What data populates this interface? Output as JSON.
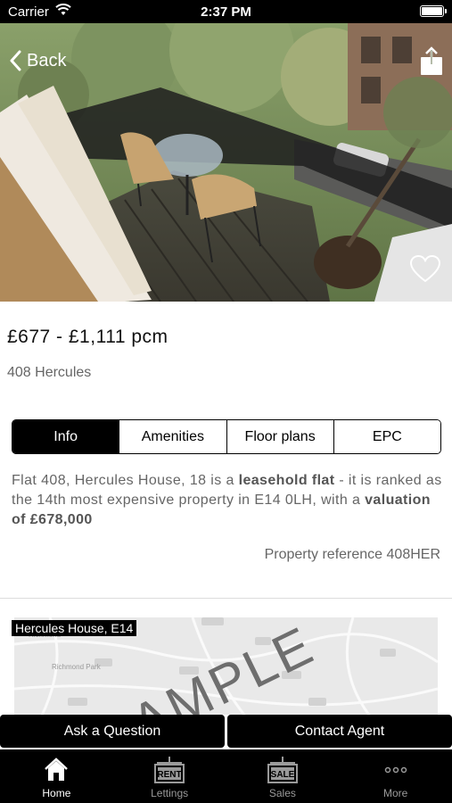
{
  "status_bar": {
    "carrier": "Carrier",
    "time": "2:37 PM",
    "battery_level": 1.0
  },
  "header": {
    "back_label": "Back",
    "share_icon": "share-icon",
    "favorite_icon": "heart-icon"
  },
  "listing": {
    "price": "£677 - £1,111 pcm",
    "address": "408 Hercules"
  },
  "tabs": [
    {
      "label": "Info",
      "active": true
    },
    {
      "label": "Amenities",
      "active": false
    },
    {
      "label": "Floor plans",
      "active": false
    },
    {
      "label": "EPC",
      "active": false
    }
  ],
  "info": {
    "desc_part1": "Flat 408, Hercules House, 18 is a ",
    "desc_bold1": "leasehold flat",
    "desc_part2": " - it is ranked as the 14th most expensive property in E14 0LH, with a ",
    "desc_bold2": "valuation of £678,000",
    "reference": "Property reference 408HER"
  },
  "map": {
    "label": "Hercules House, E14",
    "watermark": "SAMPLE",
    "place_1": "Richmond",
    "place_2": "Richmond Park"
  },
  "actions": {
    "ask": "Ask a Question",
    "contact": "Contact Agent"
  },
  "tabbar": [
    {
      "label": "Home",
      "icon": "home-icon",
      "active": true
    },
    {
      "label": "Lettings",
      "icon": "rent-sign-icon",
      "badge": "RENT",
      "active": false
    },
    {
      "label": "Sales",
      "icon": "sale-sign-icon",
      "badge": "SALE",
      "active": false
    },
    {
      "label": "More",
      "icon": "more-dots-icon",
      "active": false
    }
  ],
  "colors": {
    "accent": "#000000",
    "muted_text": "#666666"
  }
}
